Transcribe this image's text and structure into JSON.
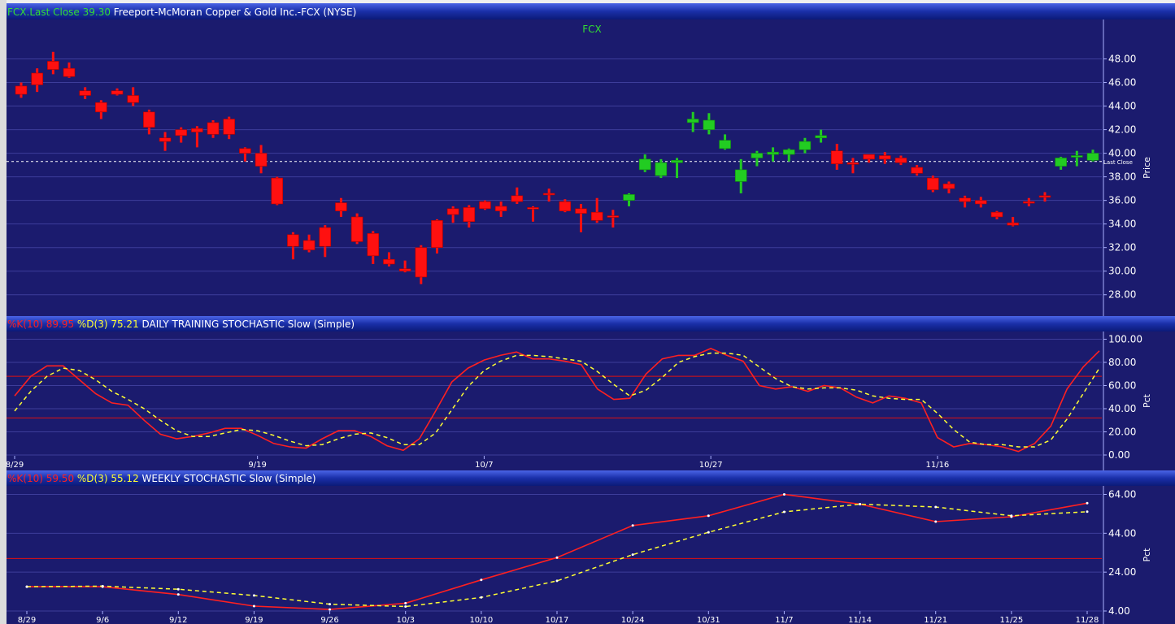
{
  "colors": {
    "panel_bg": "#1b1b6e",
    "grid": "#3d3d9a",
    "header_bg": "#1a2fa8",
    "down_candle": "#ff1010",
    "up_candle": "#22cc22",
    "k_line": "#ff2020",
    "d_line": "#ffff33",
    "threshold": "#e01010",
    "last_close_line": "#ffffff"
  },
  "chart_data": [
    {
      "type": "candlestick",
      "header": {
        "parts": [
          {
            "text": "FCX.Last Close 39.30",
            "color": "#33dd33"
          },
          {
            "text": " Freeport-McMoran Copper & Gold Inc.-FCX (NYSE)",
            "color": "#ffffff"
          }
        ]
      },
      "title": "FCX",
      "ylabel": "Price",
      "ylim": [
        27.5,
        49
      ],
      "yticks": [
        "48.00",
        "46.00",
        "44.00",
        "42.00",
        "40.00",
        "38.00",
        "36.00",
        "34.00",
        "32.00",
        "30.00",
        "28.00"
      ],
      "last_close": 39.3,
      "last_close_label": "Last Close",
      "candles": [
        {
          "o": 45.7,
          "c": 45.0,
          "h": 46.0,
          "l": 44.7
        },
        {
          "o": 46.8,
          "c": 45.8,
          "h": 47.2,
          "l": 45.2
        },
        {
          "o": 47.8,
          "c": 47.1,
          "h": 48.6,
          "l": 46.7
        },
        {
          "o": 47.2,
          "c": 46.5,
          "h": 47.7,
          "l": 46.4
        },
        {
          "o": 45.3,
          "c": 44.9,
          "h": 45.6,
          "l": 44.6
        },
        {
          "o": 44.3,
          "c": 43.5,
          "h": 44.5,
          "l": 42.9
        },
        {
          "o": 45.3,
          "c": 45.0,
          "h": 45.5,
          "l": 44.9
        },
        {
          "o": 44.9,
          "c": 44.3,
          "h": 45.6,
          "l": 44.0
        },
        {
          "o": 43.5,
          "c": 42.2,
          "h": 43.7,
          "l": 41.6
        },
        {
          "o": 41.3,
          "c": 41.0,
          "h": 41.8,
          "l": 40.2
        },
        {
          "o": 42.0,
          "c": 41.5,
          "h": 42.2,
          "l": 40.9
        },
        {
          "o": 42.1,
          "c": 41.8,
          "h": 42.3,
          "l": 40.5
        },
        {
          "o": 42.6,
          "c": 41.6,
          "h": 42.8,
          "l": 41.3
        },
        {
          "o": 42.9,
          "c": 41.6,
          "h": 43.1,
          "l": 41.2
        },
        {
          "o": 40.4,
          "c": 40.0,
          "h": 40.5,
          "l": 39.3
        },
        {
          "o": 40.0,
          "c": 38.9,
          "h": 40.7,
          "l": 38.3
        },
        {
          "o": 37.9,
          "c": 35.7,
          "h": 38.0,
          "l": 35.6
        },
        {
          "o": 33.1,
          "c": 32.1,
          "h": 33.3,
          "l": 31.0
        },
        {
          "o": 32.6,
          "c": 31.8,
          "h": 33.1,
          "l": 31.6
        },
        {
          "o": 33.7,
          "c": 32.1,
          "h": 33.9,
          "l": 31.2
        },
        {
          "o": 35.8,
          "c": 35.1,
          "h": 36.2,
          "l": 34.6
        },
        {
          "o": 34.6,
          "c": 32.5,
          "h": 34.9,
          "l": 32.3
        },
        {
          "o": 33.2,
          "c": 31.3,
          "h": 33.4,
          "l": 30.6
        },
        {
          "o": 31.0,
          "c": 30.6,
          "h": 31.6,
          "l": 30.4
        },
        {
          "o": 30.2,
          "c": 30.0,
          "h": 30.9,
          "l": 29.9
        },
        {
          "o": 32.0,
          "c": 29.5,
          "h": 32.2,
          "l": 28.9
        },
        {
          "o": 34.3,
          "c": 32.0,
          "h": 34.4,
          "l": 31.5
        },
        {
          "o": 35.3,
          "c": 34.8,
          "h": 35.5,
          "l": 34.1
        },
        {
          "o": 35.4,
          "c": 34.2,
          "h": 35.6,
          "l": 33.7
        },
        {
          "o": 35.9,
          "c": 35.3,
          "h": 36.0,
          "l": 35.2
        },
        {
          "o": 35.5,
          "c": 35.1,
          "h": 35.9,
          "l": 34.6
        },
        {
          "o": 36.4,
          "c": 35.9,
          "h": 37.1,
          "l": 35.7
        },
        {
          "o": 35.4,
          "c": 35.3,
          "h": 35.5,
          "l": 34.2
        },
        {
          "o": 36.6,
          "c": 36.5,
          "h": 37.0,
          "l": 35.9
        },
        {
          "o": 35.9,
          "c": 35.1,
          "h": 36.1,
          "l": 35.0
        },
        {
          "o": 35.3,
          "c": 34.9,
          "h": 35.7,
          "l": 33.3
        },
        {
          "o": 35.0,
          "c": 34.3,
          "h": 36.2,
          "l": 34.1
        },
        {
          "o": 34.7,
          "c": 34.6,
          "h": 35.2,
          "l": 33.7
        },
        {
          "o": 36.0,
          "c": 36.5,
          "h": 36.6,
          "l": 35.5
        },
        {
          "o": 38.6,
          "c": 39.5,
          "h": 39.9,
          "l": 38.4
        },
        {
          "o": 38.1,
          "c": 39.2,
          "h": 39.5,
          "l": 37.9
        },
        {
          "o": 39.2,
          "c": 39.4,
          "h": 39.6,
          "l": 37.9
        },
        {
          "o": 42.6,
          "c": 42.9,
          "h": 43.5,
          "l": 41.8
        },
        {
          "o": 42.0,
          "c": 42.8,
          "h": 43.4,
          "l": 41.6
        },
        {
          "o": 40.4,
          "c": 41.1,
          "h": 41.6,
          "l": 40.3
        },
        {
          "o": 37.6,
          "c": 38.6,
          "h": 39.5,
          "l": 36.6
        },
        {
          "o": 39.6,
          "c": 40.0,
          "h": 40.2,
          "l": 38.9
        },
        {
          "o": 39.9,
          "c": 40.1,
          "h": 40.5,
          "l": 39.3
        },
        {
          "o": 39.9,
          "c": 40.3,
          "h": 40.4,
          "l": 39.3
        },
        {
          "o": 40.3,
          "c": 41.0,
          "h": 41.3,
          "l": 40.0
        },
        {
          "o": 41.3,
          "c": 41.5,
          "h": 42.0,
          "l": 40.9
        },
        {
          "o": 40.2,
          "c": 39.1,
          "h": 40.8,
          "l": 38.6
        },
        {
          "o": 39.2,
          "c": 39.1,
          "h": 39.6,
          "l": 38.3
        },
        {
          "o": 39.9,
          "c": 39.5,
          "h": 39.9,
          "l": 39.2
        },
        {
          "o": 39.8,
          "c": 39.5,
          "h": 40.1,
          "l": 39.1
        },
        {
          "o": 39.6,
          "c": 39.2,
          "h": 39.8,
          "l": 39.0
        },
        {
          "o": 38.8,
          "c": 38.3,
          "h": 39.0,
          "l": 38.1
        },
        {
          "o": 37.9,
          "c": 36.9,
          "h": 38.1,
          "l": 36.7
        },
        {
          "o": 37.4,
          "c": 37.0,
          "h": 37.6,
          "l": 36.6
        },
        {
          "o": 36.2,
          "c": 35.9,
          "h": 36.4,
          "l": 35.4
        },
        {
          "o": 36.0,
          "c": 35.7,
          "h": 36.3,
          "l": 35.4
        },
        {
          "o": 35.0,
          "c": 34.6,
          "h": 35.1,
          "l": 34.4
        },
        {
          "o": 34.1,
          "c": 33.9,
          "h": 34.6,
          "l": 33.8
        },
        {
          "o": 35.9,
          "c": 35.8,
          "h": 36.2,
          "l": 35.5
        },
        {
          "o": 36.4,
          "c": 36.3,
          "h": 36.7,
          "l": 35.9
        },
        {
          "o": 38.9,
          "c": 39.6,
          "h": 39.7,
          "l": 38.6
        },
        {
          "o": 39.7,
          "c": 39.8,
          "h": 40.2,
          "l": 38.9
        },
        {
          "o": 39.4,
          "c": 40.0,
          "h": 40.3,
          "l": 39.3
        }
      ]
    },
    {
      "type": "line",
      "header": {
        "parts": [
          {
            "text": "%K(10) 89.95",
            "color": "#ff2020"
          },
          {
            "text": "  %D(3) 75.21",
            "color": "#ffff33"
          },
          {
            "text": " DAILY TRAINING STOCHASTIC Slow (Simple)",
            "color": "#ffffff"
          }
        ]
      },
      "ylabel": "Pct",
      "ylim": [
        0,
        100
      ],
      "yticks": [
        "100.00",
        "80.00",
        "60.00",
        "40.00",
        "20.00",
        "0.00"
      ],
      "thresholds": [
        68,
        32
      ],
      "xtick_labels": [
        {
          "label": "8/29",
          "index": 0
        },
        {
          "label": "9/19",
          "index": 15
        },
        {
          "label": "10/7",
          "index": 29
        },
        {
          "label": "10/27",
          "index": 43
        },
        {
          "label": "11/16",
          "index": 57
        }
      ],
      "series": [
        {
          "line": "k",
          "values": [
            51,
            68,
            77,
            77,
            65,
            53,
            45,
            43,
            30,
            18,
            14,
            16,
            19,
            23,
            23,
            17,
            10,
            7,
            6,
            14,
            21,
            21,
            16,
            8,
            4,
            14,
            38,
            63,
            75,
            82,
            86,
            89,
            83,
            83,
            81,
            78,
            57,
            48,
            49,
            70,
            83,
            86,
            86,
            92,
            86,
            81,
            60,
            57,
            59,
            55,
            60,
            58,
            50,
            45,
            51,
            49,
            45,
            15,
            7,
            10,
            9,
            7,
            3,
            10,
            25,
            57,
            76,
            90
          ]
        },
        {
          "line": "d",
          "values": [
            38,
            55,
            68,
            75,
            73,
            65,
            55,
            48,
            40,
            30,
            21,
            16,
            16,
            19,
            22,
            21,
            17,
            12,
            8,
            9,
            14,
            18,
            19,
            15,
            9,
            9,
            19,
            39,
            59,
            73,
            81,
            86,
            86,
            85,
            83,
            81,
            72,
            61,
            51,
            56,
            67,
            80,
            85,
            88,
            88,
            86,
            76,
            66,
            59,
            57,
            58,
            58,
            56,
            51,
            49,
            48,
            48,
            36,
            22,
            11,
            9,
            9,
            7,
            7,
            13,
            31,
            53,
            75
          ]
        }
      ]
    },
    {
      "type": "line",
      "header": {
        "parts": [
          {
            "text": "%K(10) 59.50",
            "color": "#ff2020"
          },
          {
            "text": "  %D(3) 55.12",
            "color": "#ffff33"
          },
          {
            "text": " WEEKLY STOCHASTIC Slow (Simple)",
            "color": "#ffffff"
          }
        ]
      },
      "ylabel": "Pct",
      "ylim": [
        4,
        64
      ],
      "yticks": [
        "64.00",
        "44.00",
        "24.00",
        "4.00"
      ],
      "threshold": 31,
      "categories": [
        "8/29",
        "9/6",
        "9/12",
        "9/19",
        "9/26",
        "10/3",
        "10/10",
        "10/17",
        "10/24",
        "10/31",
        "11/7",
        "11/14",
        "11/21",
        "11/25",
        "11/28"
      ],
      "series": [
        {
          "line": "k",
          "values": [
            16.5,
            16.5,
            12.5,
            6.5,
            4.8,
            8.0,
            20.0,
            31.5,
            48.0,
            53.0,
            64.0,
            59.0,
            50.0,
            52.5,
            59.5
          ]
        },
        {
          "line": "d",
          "values": [
            16.5,
            16.8,
            15.2,
            12.0,
            7.5,
            6.3,
            11.0,
            19.5,
            33.0,
            44.5,
            55.0,
            59.0,
            57.5,
            53.0,
            55.1
          ]
        }
      ]
    }
  ]
}
